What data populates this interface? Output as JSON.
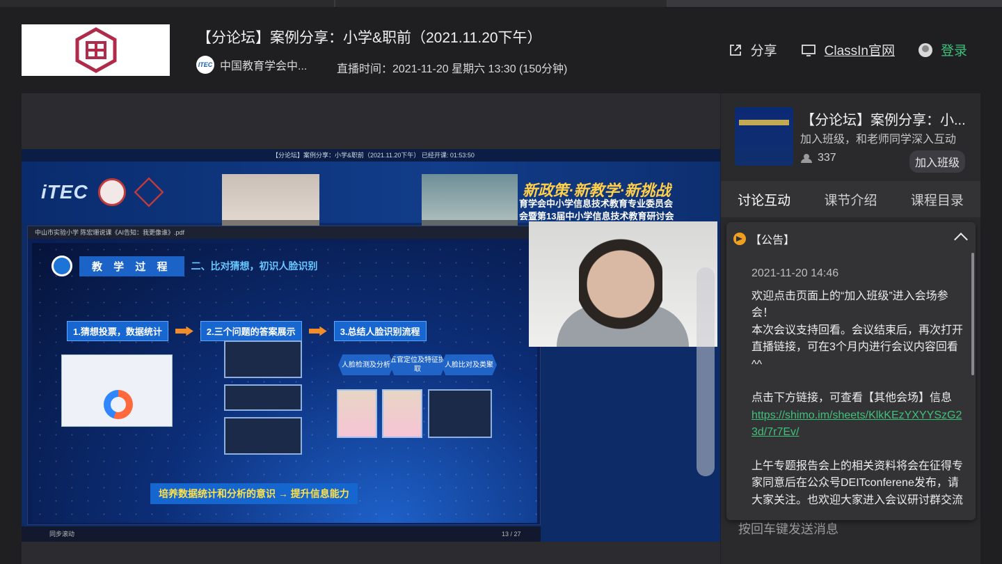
{
  "header": {
    "title": "【分论坛】案例分享：小学&职前（2021.11.20下午）",
    "org_avatar_text": "ITEC",
    "org_name": "中国教育学会中...",
    "live_time": "直播时间：2021-11-20 星期六 13:30 (150分钟)",
    "share_label": "分享",
    "website_label": "ClassIn官网",
    "login_label": "登录"
  },
  "stream": {
    "top_bar_text": "【分论坛】案例分享：小学&职前（2021.11.20下午）  已经开课: 01:53:50",
    "banner_logo_text": "iTEC",
    "slogan": "新政策·新教学·新挑战",
    "conference_line1": "育学会中小学信息技术教育专业委员会",
    "conference_line2": "会暨第13届中小学信息技术教育研讨会",
    "pdf_title": "中山市实验小学 陈宏珊说课《AI告知：我更像谁》.pdf",
    "section_tag": "教 学 过 程",
    "section_sub": "二、比对猜想，初识人脸识别",
    "step1": "1.猜想投票，数据统计",
    "step2": "2.三个问题的答案展示",
    "step3": "3.总结人脸识别流程",
    "hex1": "人脸检测及分析",
    "hex2": "五官定位及特征提取",
    "hex3": "人脸比对及类聚",
    "bottom_banner": "培养数据统计和分析的意识 → 提升信息能力",
    "pdf_footer": "同步滚动",
    "page_indicator": "13 / 27"
  },
  "sidebar": {
    "course_title": "【分论坛】案例分享：小...",
    "course_sub": "加入班级，和老师同学深入互动",
    "member_count": "337",
    "join_button": "加入班级",
    "tabs": [
      {
        "label": "讨论互动",
        "active": true
      },
      {
        "label": "课节介绍",
        "active": false
      },
      {
        "label": "课程目录",
        "active": false
      }
    ],
    "send_hint": "按回车键发送消息"
  },
  "notice": {
    "header": "【公告】",
    "date": "2021-11-20 14:46",
    "p1": "欢迎点击页面上的“加入班级”进入会场参会！",
    "p2": "本次会议支持回看。会议结束后，再次打开直播链接，可在3个月内进行会议内容回看^^",
    "p3": "点击下方链接，可查看【其他会场】信息",
    "link": "https://shimo.im/sheets/KlkKEzYXYYSzG23d/7r7Ev/",
    "p4": "上午专题报告会上的相关资料将会在征得专家同意后在公众号DEITconferene发布，请大家关注。也欢迎大家进入会议研讨群交流"
  },
  "colors": {
    "accent_green": "#3ec27a",
    "background": "#1f1f22",
    "sidebar": "#2a2a2d"
  }
}
